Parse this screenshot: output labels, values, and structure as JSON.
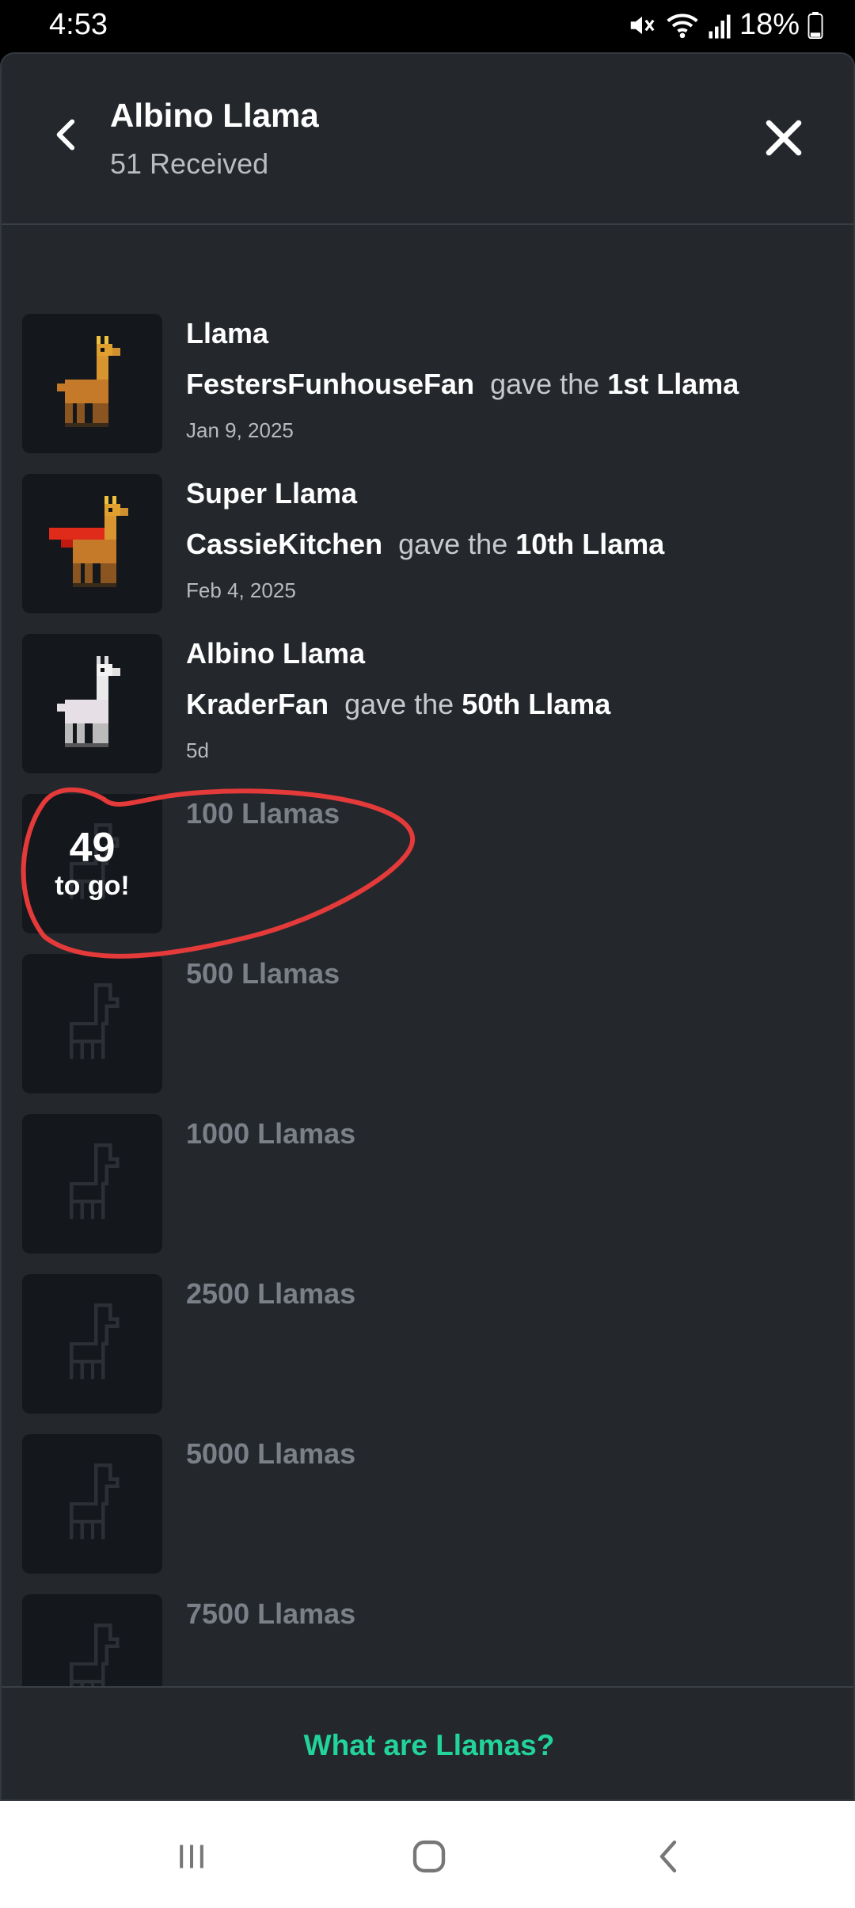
{
  "status_bar": {
    "time": "4:53",
    "battery": "18%",
    "icons": [
      "mute-icon",
      "wifi-icon",
      "signal-icon",
      "battery-icon"
    ]
  },
  "header": {
    "title": "Albino Llama",
    "subtitle": "51 Received",
    "back_icon": "chevron-left-icon",
    "close_icon": "close-icon"
  },
  "awards": [
    {
      "title": "Llama",
      "giver": "FestersFunhouseFan",
      "gave_text": "gave the",
      "ordinal": "1st Llama",
      "date": "Jan 9, 2025",
      "icon": "llama-icon"
    },
    {
      "title": "Super Llama",
      "giver": "CassieKitchen",
      "gave_text": "gave the",
      "ordinal": "10th Llama",
      "date": "Feb 4, 2025",
      "icon": "super-llama-icon"
    },
    {
      "title": "Albino Llama",
      "giver": "KraderFan",
      "gave_text": "gave the",
      "ordinal": "50th Llama",
      "date": "5d",
      "icon": "albino-llama-icon"
    }
  ],
  "milestones": [
    {
      "title": "100 Llamas",
      "togo_count": "49",
      "togo_label": "to go!"
    },
    {
      "title": "500 Llamas"
    },
    {
      "title": "1000 Llamas"
    },
    {
      "title": "2500 Llamas"
    },
    {
      "title": "5000 Llamas"
    },
    {
      "title": "7500 Llamas"
    }
  ],
  "footer": {
    "link_label": "What are Llamas?"
  },
  "colors": {
    "background": "#24282d",
    "accent": "#22d49a",
    "annotation": "#e53a3a"
  },
  "navbar": {
    "icons": [
      "recent-apps-icon",
      "home-icon",
      "back-icon"
    ]
  }
}
